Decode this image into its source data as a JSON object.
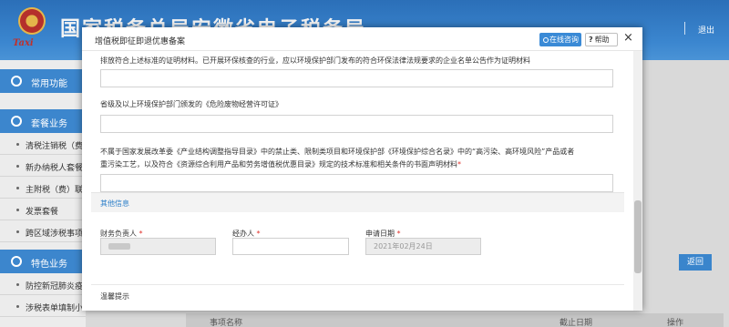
{
  "background": {
    "logo_text": "Taxi",
    "site_title": "国家税务总局安徽省电子税务局",
    "exit_label": "退出",
    "sidebar": {
      "common_label": "常用功能",
      "tax_business_label": "套餐业务",
      "tax_items": [
        "清税注销税（费",
        "新办纳税人套餐",
        "主附税（费）联",
        "发票套餐",
        "跨区域涉税事项"
      ],
      "special_label": "特色业务",
      "special_items": [
        "防控新冠肺炎疫",
        "涉税表单填制小"
      ]
    },
    "return_label": "返回",
    "table_headers": [
      "事项名称",
      "截止日期",
      "操作"
    ]
  },
  "modal": {
    "title": "增值税即征即退优惠备案",
    "online_button": "在线咨询",
    "help_button": "帮助",
    "close_glyph": "×",
    "partial_question_line": "排放符合上述标准的证明材料。已开展环保核查的行业，应以环境保护部门发布的符合环保法律法规要求的企业名单公告作为证明材料",
    "question_2": "省级及以上环境保护部门颁发的《危险废物经营许可证》",
    "question_3_line1": "不属于国家发展改革委《产业结构调整指导目录》中的禁止类、限制类项目和环境保护部《环境保护综合名录》中的“高污染、高环境风险”产品或者",
    "question_3_line2": "重污染工艺，以及符合《资源综合利用产品和劳务增值税优惠目录》规定的技术标准和相关条件的书面声明材料",
    "required_mark": "*",
    "section_other": "其他信息",
    "finance_label": "财务负责人",
    "handler_label": "经办人",
    "date_label": "申请日期",
    "date_value": "2021年02月24日",
    "notice_label": "温馨提示"
  }
}
